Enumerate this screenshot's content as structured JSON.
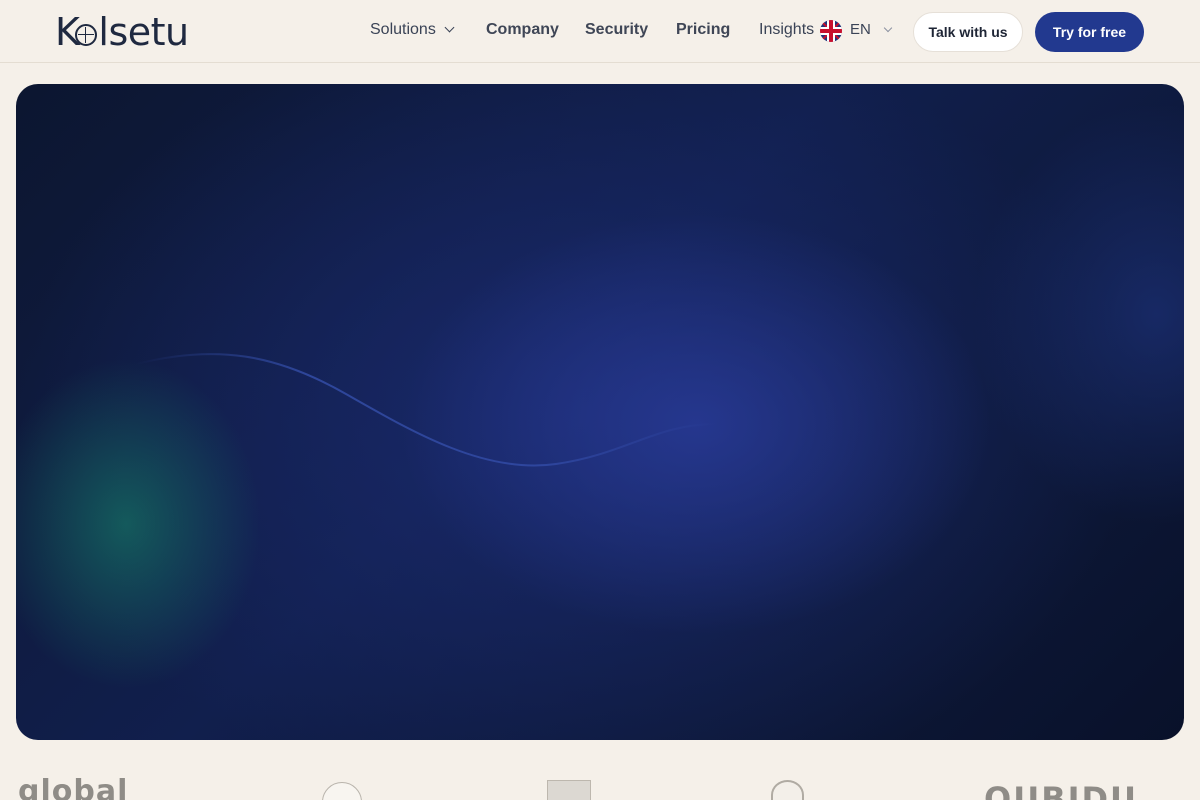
{
  "header": {
    "brand": "Kolsetu",
    "nav": {
      "solutions": "Solutions",
      "company": "Company",
      "security": "Security",
      "pricing": "Pricing",
      "insights": "Insights"
    },
    "language": "EN",
    "talk_label": "Talk with us",
    "try_label": "Try for free"
  },
  "logos": {
    "global": "global",
    "qubidu": "QUBIDU"
  },
  "colors": {
    "background": "#f5f0e9",
    "primary": "#22398f",
    "hero_dark": "#0c1630",
    "hero_teal": "#14645f"
  }
}
